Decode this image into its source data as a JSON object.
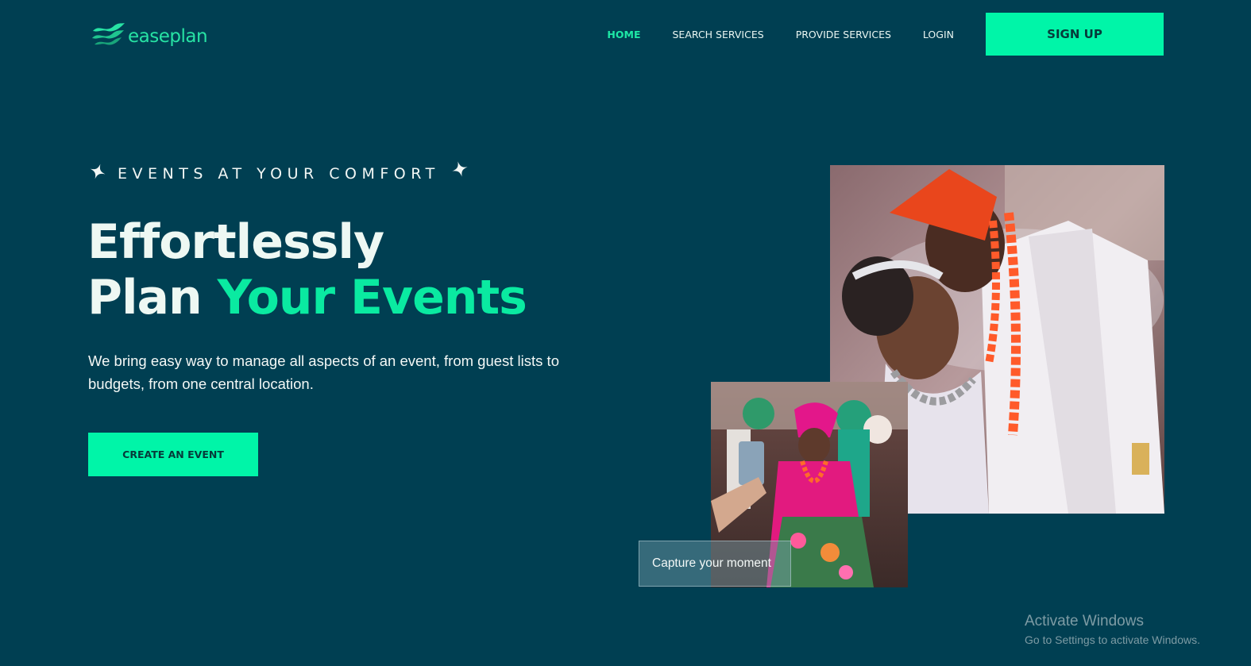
{
  "logo": {
    "text": "easeplan",
    "icon": "wave-icon"
  },
  "nav": {
    "items": [
      {
        "label": "HOME"
      },
      {
        "label": "SEARCH SERVICES"
      },
      {
        "label": "PROVIDE SERVICES"
      },
      {
        "label": "LOGIN"
      }
    ],
    "signup_label": "SIGN UP"
  },
  "hero": {
    "tagline": "EVENTS AT YOUR COMFORT",
    "headline_line1": "Effortlessly",
    "headline_line2_a": "Plan ",
    "headline_line2_b": "Your Events",
    "description": "We bring easy way to manage all aspects of an event, from guest lists to budgets, from one central location.",
    "cta_label": "CREATE AN EVENT"
  },
  "gallery": {
    "caption": "Capture your moment"
  },
  "system_overlay": {
    "title": "Activate Windows",
    "subtitle": "Go to Settings to activate Windows."
  },
  "colors": {
    "background": "#003f52",
    "accent": "#00f5a8",
    "accent_text": "#0aeaa1"
  }
}
